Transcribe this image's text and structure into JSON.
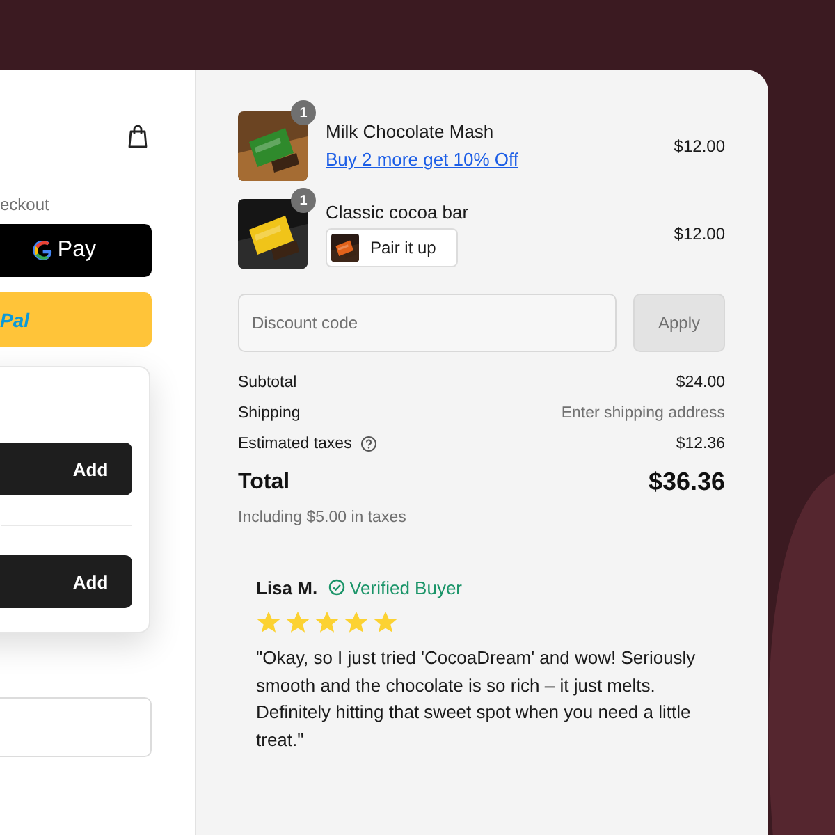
{
  "express_checkout": {
    "label": "eckout",
    "payment_buttons": [
      {
        "kind": "gpay",
        "label": "Pay"
      },
      {
        "kind": "paypal",
        "label": "Pal"
      }
    ],
    "upsell_buttons": [
      "Add",
      "Add"
    ]
  },
  "order": {
    "items": [
      {
        "name": "Milk Chocolate Mash",
        "quantity": "1",
        "price": "$12.00",
        "kind": "promo",
        "link": "Buy 2 more get 10% Off"
      },
      {
        "name": "Classic cocoa bar",
        "quantity": "1",
        "price": "$12.00",
        "kind": "pair",
        "action": "Pair it up"
      }
    ],
    "discount": {
      "placeholder": "Discount code",
      "button": "Apply"
    },
    "summary": [
      {
        "label": "Subtotal",
        "value": "$24.00",
        "muted": false,
        "help": false
      },
      {
        "label": "Shipping",
        "value": "Enter shipping address",
        "muted": true,
        "help": false
      },
      {
        "label": "Estimated taxes",
        "value": "$12.36",
        "muted": false,
        "help": true
      }
    ],
    "total": {
      "label": "Total",
      "value": "$36.36"
    },
    "tax_note": "Including $5.00 in taxes"
  },
  "review": {
    "name": "Lisa M.",
    "badge": "Verified Buyer",
    "stars": 5,
    "text": "\"Okay, so I just tried 'CocoaDream' and wow! Seriously smooth and the chocolate is so rich – it just melts. Definitely hitting that sweet spot when you need a little treat.\""
  }
}
